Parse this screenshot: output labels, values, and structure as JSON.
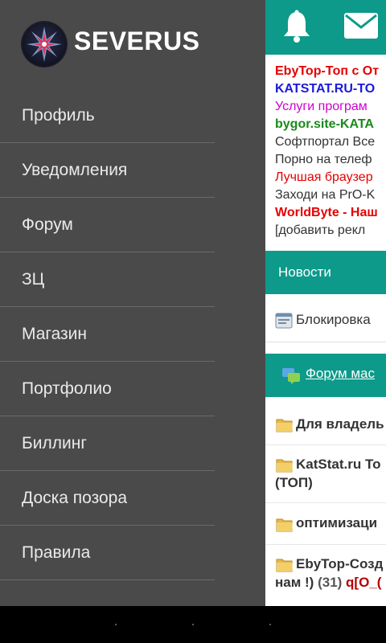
{
  "app": {
    "brand": "SEVERUS"
  },
  "drawer": {
    "items": [
      {
        "label": "Профиль"
      },
      {
        "label": "Уведомления"
      },
      {
        "label": "Форум"
      },
      {
        "label": "ЗЦ"
      },
      {
        "label": "Магазин"
      },
      {
        "label": "Портфолио"
      },
      {
        "label": "Биллинг"
      },
      {
        "label": "Доска позора"
      },
      {
        "label": "Правила"
      }
    ]
  },
  "topbar": {
    "icons": [
      "bell-icon",
      "mail-icon"
    ],
    "color": "#0d9a8a"
  },
  "ads": [
    {
      "text": "EbyTop-Топ с От"
    },
    {
      "text": "KATSTAT.RU-TO"
    },
    {
      "text": "Услуги програм"
    },
    {
      "text": "bygor.site-KATA"
    },
    {
      "text": "Софтпортал Все"
    },
    {
      "text": "Порно на телеф"
    },
    {
      "text": "Лучшая браузер"
    },
    {
      "text": "Заходи на PrO-K"
    },
    {
      "text": "WorldByte - Наш"
    },
    {
      "text": "[добавить рекл"
    }
  ],
  "news": {
    "header": "Новости",
    "item": "Блокировка"
  },
  "forum": {
    "link": "Форум мас",
    "topics": [
      {
        "line1": "Для владель",
        "line2": ""
      },
      {
        "line1": "KatStat.ru To",
        "line2": "(ТОП)"
      },
      {
        "line1": "оптимизаци",
        "line2": ""
      },
      {
        "line1": "EbyTop-Созд",
        "line2_prefix": "нам !)",
        "count": "(31)",
        "user": "q[O_("
      }
    ]
  }
}
